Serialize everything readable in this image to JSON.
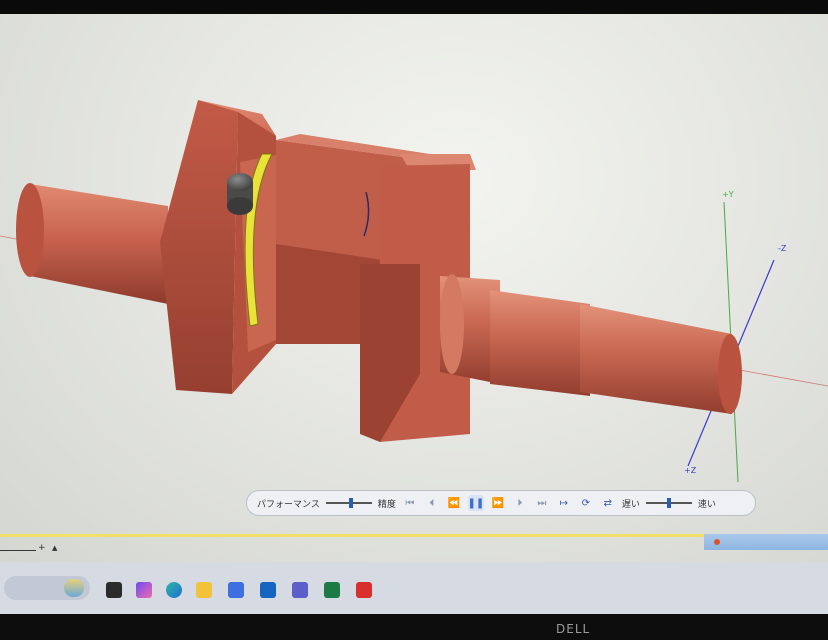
{
  "toolbar": {
    "performance_label": "パフォーマンス",
    "accuracy_label": "精度",
    "slow_label": "遅い",
    "fast_label": "速い",
    "performance_level": 0.5,
    "speed_level": 0.45
  },
  "axes": {
    "z_top_label": "-Z",
    "z_bottom_label": "+Z",
    "y_label": "+Y"
  },
  "status": {
    "left_plus": "+",
    "left_arrow": "▲"
  },
  "colors": {
    "part": "#c8634f",
    "highlight": "#e8e23a",
    "toolbar_accent": "#3a6fd0",
    "taskbar_strip": "#1f4fa6"
  },
  "bezel": {
    "brand": "DELL"
  }
}
